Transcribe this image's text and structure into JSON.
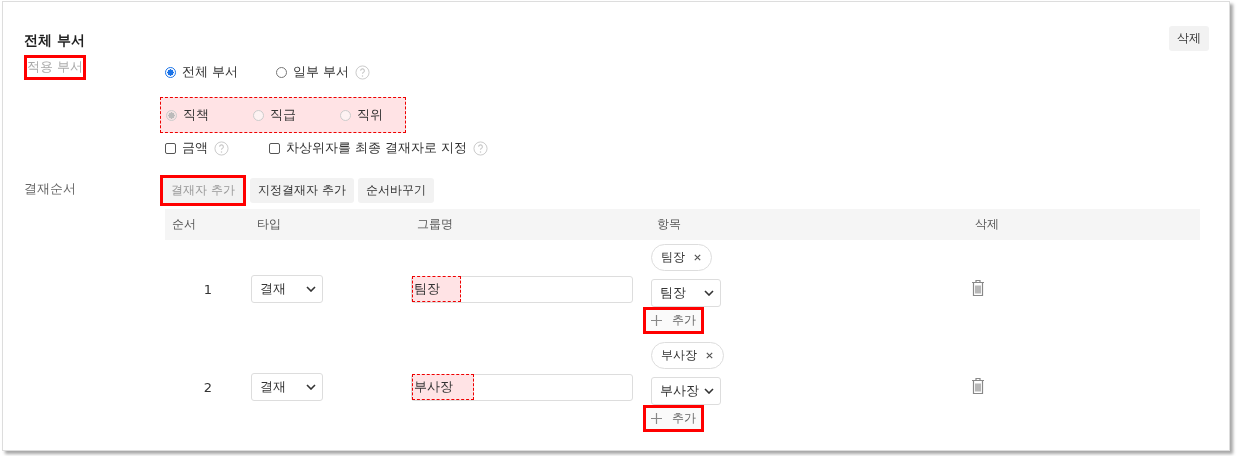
{
  "section": {
    "title": "전체 부서",
    "delete_button": "삭제"
  },
  "scope": {
    "label": "적용 부서",
    "label_highlighted": true,
    "options": [
      {
        "label": "전체 부서",
        "selected": true,
        "help": false
      },
      {
        "label": "일부 부서",
        "selected": false,
        "help": true
      }
    ]
  },
  "basis": {
    "highlighted": true,
    "options": [
      {
        "label": "직책",
        "selected": true,
        "disabled": true
      },
      {
        "label": "직급",
        "selected": false,
        "disabled": true
      },
      {
        "label": "직위",
        "selected": false,
        "disabled": true
      }
    ]
  },
  "checks": [
    {
      "label": "금액",
      "checked": false,
      "help": true
    },
    {
      "label": "차상위자를 최종 결재자로 지정",
      "checked": false,
      "help": true
    }
  ],
  "approval": {
    "label": "결재순서",
    "buttons": [
      {
        "label": "결재자 추가",
        "highlighted": true,
        "disabled": true
      },
      {
        "label": "지정결재자 추가",
        "highlighted": false,
        "disabled": false
      },
      {
        "label": "순서바꾸기",
        "highlighted": false,
        "disabled": false
      }
    ],
    "columns": [
      "순서",
      "타입",
      "그룹명",
      "항목",
      "삭제"
    ],
    "rows": [
      {
        "order": "1",
        "type": "결재",
        "group_name": "팀장",
        "group_highlighted": true,
        "tags": [
          "팀장"
        ],
        "item_select": "팀장",
        "add_label": "추가",
        "add_highlighted": true
      },
      {
        "order": "2",
        "type": "결재",
        "group_name": "부사장",
        "group_highlighted": true,
        "tags": [
          "부사장"
        ],
        "item_select": "부사장",
        "add_label": "추가",
        "add_highlighted": true
      }
    ]
  }
}
